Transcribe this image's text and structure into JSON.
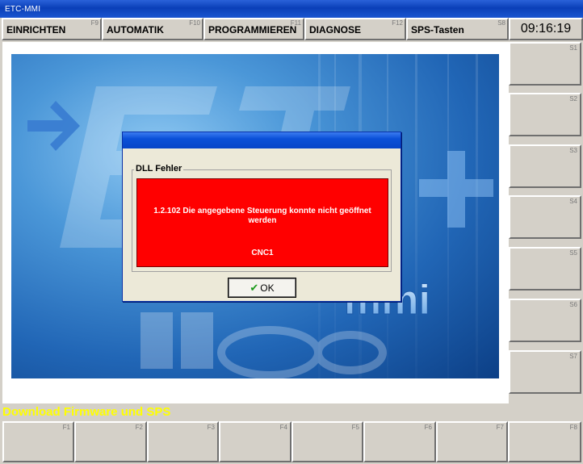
{
  "window": {
    "title": "ETC-MMI"
  },
  "menu": [
    {
      "label": "EINRICHTEN",
      "fkey": "F9"
    },
    {
      "label": "AUTOMATIK",
      "fkey": "F10"
    },
    {
      "label": "PROGRAMMIEREN",
      "fkey": "F11"
    },
    {
      "label": "DIAGNOSE",
      "fkey": "F12"
    },
    {
      "label": "SPS-Tasten",
      "fkey": "S8"
    }
  ],
  "clock": "09:16:19",
  "side_buttons": [
    "S1",
    "S2",
    "S3",
    "S4",
    "S5",
    "S6",
    "S7"
  ],
  "splash": {
    "wordmark": "mmi",
    "arrow_icon": "arrow-right-icon"
  },
  "dialog": {
    "group_label": "DLL Fehler",
    "error_message": "1.2.102 Die angegebene Steuerung konnte nicht geöffnet werden",
    "error_detail": "CNC1",
    "ok_label": "OK",
    "ok_icon": "checkmark-icon",
    "error_color": "#ff0000"
  },
  "status_text": "Download Firmware und SPS",
  "bottom_buttons": [
    "F1",
    "F2",
    "F3",
    "F4",
    "F5",
    "F6",
    "F7",
    "F8"
  ]
}
